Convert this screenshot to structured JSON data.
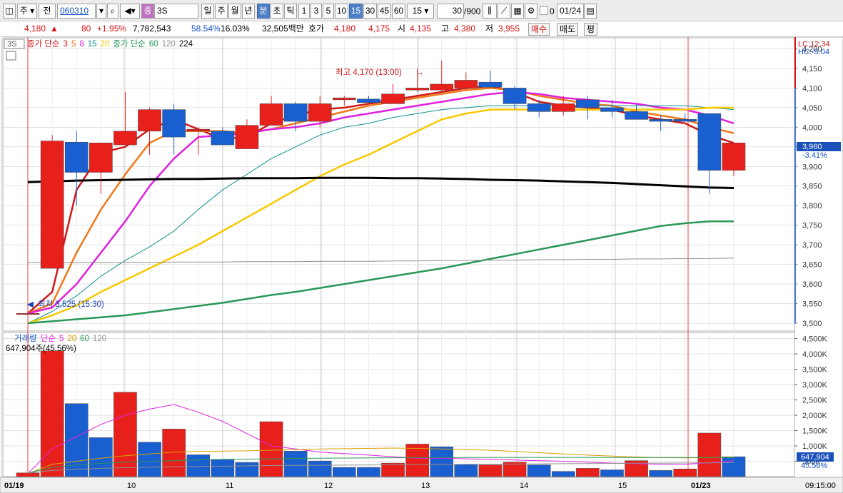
{
  "toolbar": {
    "market": "주",
    "prev": "전",
    "code": "060310",
    "stock_name": "3S",
    "period_buttons": [
      "일",
      "주",
      "월",
      "년",
      "분",
      "초",
      "틱"
    ],
    "active_period": "분",
    "minute_buttons": [
      "1",
      "3",
      "5",
      "10",
      "15",
      "30",
      "45",
      "60"
    ],
    "active_minute": "15",
    "minute_select": "15",
    "count": "30",
    "count_max": "/900",
    "date": "01/24",
    "checkbox_label": "0"
  },
  "infobar": {
    "price": "4,180",
    "change_arrow": "▲",
    "change": "80",
    "change_pct": "+1.95%",
    "volume": "7,782,543",
    "vol_ratio": "58.54%",
    "turnover": "16.03%",
    "amount": "32,505백만",
    "quote_label": "호가",
    "ask": "4,180",
    "bid": "4,175",
    "open_label": "시",
    "open": "4,135",
    "high_label": "고",
    "high": "4,380",
    "low_label": "저",
    "low": "3,955",
    "buy_label": "매수",
    "sell_label": "매도",
    "eval_label": "평"
  },
  "price_panel": {
    "name_tag": "3S",
    "legend": [
      {
        "text": "종가 단순",
        "color": "#d01818"
      },
      {
        "text": "3",
        "color": "#d01818"
      },
      {
        "text": "5",
        "color": "#f07818"
      },
      {
        "text": "8",
        "color": "#e020e0"
      },
      {
        "text": "15",
        "color": "#109090"
      },
      {
        "text": "20",
        "color": "#f8c800"
      },
      {
        "text": "종가 단순",
        "color": "#289858"
      },
      {
        "text": "60",
        "color": "#289858"
      },
      {
        "text": "120",
        "color": "#909090"
      },
      {
        "text": "224",
        "color": "#000000"
      }
    ],
    "lc": "LC:12.34",
    "hc": "HC:-5.04",
    "current_price": "3,960",
    "current_pct": "-3.41%",
    "high_annot": "최고 4,170 (13:00)",
    "low_annot": "최저 3,525 (15:30)"
  },
  "volume_panel": {
    "legend": [
      {
        "text": "거래량",
        "color": "#1450c8"
      },
      {
        "text": "단순",
        "color": "#e020e0"
      },
      {
        "text": "5",
        "color": "#e020e0"
      },
      {
        "text": "20",
        "color": "#d8a000"
      },
      {
        "text": "60",
        "color": "#289858"
      },
      {
        "text": "120",
        "color": "#909090"
      }
    ],
    "summary": "647,904주(45.56%)",
    "current_volume": "647,904",
    "current_pct": "45.56%"
  },
  "colors": {
    "up": "#e8201c",
    "down": "#1a5fd0",
    "grid": "#d0d0d0"
  },
  "chart_data": [
    {
      "type": "candlestick",
      "y_ticks": [
        "4,200",
        "4,150",
        "4,100",
        "4,050",
        "4,000",
        "3,950",
        "3,900",
        "3,850",
        "3,800",
        "3,750",
        "3,700",
        "3,650",
        "3,600",
        "3,550",
        "3,500"
      ],
      "ylim": [
        3480,
        4230
      ],
      "x_labels": [
        "01/19",
        "10",
        "11",
        "12",
        "13",
        "14",
        "15",
        "01/23",
        "09:15:00"
      ],
      "candles": [
        {
          "o": 3525,
          "h": 3530,
          "l": 3525,
          "c": 3525
        },
        {
          "o": 3640,
          "h": 3980,
          "l": 3640,
          "c": 3965
        },
        {
          "o": 3962,
          "h": 3990,
          "l": 3800,
          "c": 3885
        },
        {
          "o": 3885,
          "h": 3960,
          "l": 3830,
          "c": 3960
        },
        {
          "o": 3955,
          "h": 4090,
          "l": 3955,
          "c": 3990
        },
        {
          "o": 3990,
          "h": 4050,
          "l": 3930,
          "c": 4045
        },
        {
          "o": 4045,
          "h": 4060,
          "l": 3930,
          "c": 3975
        },
        {
          "o": 3990,
          "h": 4000,
          "l": 3930,
          "c": 3995
        },
        {
          "o": 3990,
          "h": 4000,
          "l": 3955,
          "c": 3955
        },
        {
          "o": 3945,
          "h": 4020,
          "l": 3945,
          "c": 4005
        },
        {
          "o": 4005,
          "h": 4080,
          "l": 4005,
          "c": 4060
        },
        {
          "o": 4060,
          "h": 4065,
          "l": 3990,
          "c": 4015
        },
        {
          "o": 4015,
          "h": 4080,
          "l": 4000,
          "c": 4060
        },
        {
          "o": 4070,
          "h": 4080,
          "l": 4055,
          "c": 4075
        },
        {
          "o": 4072,
          "h": 4080,
          "l": 4060,
          "c": 4063
        },
        {
          "o": 4060,
          "h": 4110,
          "l": 4060,
          "c": 4085
        },
        {
          "o": 4095,
          "h": 4150,
          "l": 4090,
          "c": 4100
        },
        {
          "o": 4095,
          "h": 4170,
          "l": 4090,
          "c": 4110
        },
        {
          "o": 4100,
          "h": 4140,
          "l": 4095,
          "c": 4120
        },
        {
          "o": 4115,
          "h": 4145,
          "l": 4105,
          "c": 4102
        },
        {
          "o": 4100,
          "h": 4105,
          "l": 4045,
          "c": 4060
        },
        {
          "o": 4060,
          "h": 4070,
          "l": 4025,
          "c": 4040
        },
        {
          "o": 4040,
          "h": 4080,
          "l": 4030,
          "c": 4060
        },
        {
          "o": 4070,
          "h": 4080,
          "l": 4020,
          "c": 4050
        },
        {
          "o": 4050,
          "h": 4070,
          "l": 4025,
          "c": 4040
        },
        {
          "o": 4040,
          "h": 4060,
          "l": 4040,
          "c": 4020
        },
        {
          "o": 4020,
          "h": 4030,
          "l": 3990,
          "c": 4015
        },
        {
          "o": 4020,
          "h": 4035,
          "l": 4015,
          "c": 4015
        },
        {
          "o": 4035,
          "h": 4035,
          "l": 3830,
          "c": 3890
        },
        {
          "o": 3890,
          "h": 3960,
          "l": 3875,
          "c": 3960
        }
      ],
      "series": [
        {
          "name": "3",
          "color": "#d01818",
          "width": 2.5,
          "values": [
            3525,
            3580,
            3840,
            3935,
            3950,
            3995,
            4020,
            3995,
            3970,
            3975,
            4010,
            4030,
            4045,
            4050,
            4060,
            4070,
            4080,
            4090,
            4100,
            4105,
            4090,
            4065,
            4055,
            4050,
            4045,
            4030,
            4020,
            4010,
            3980,
            3960
          ]
        },
        {
          "name": "5",
          "color": "#f07818",
          "width": 2.5,
          "values": [
            3525,
            3550,
            3680,
            3790,
            3880,
            3960,
            3990,
            3990,
            3990,
            3985,
            3995,
            4010,
            4025,
            4040,
            4055,
            4065,
            4075,
            4085,
            4095,
            4100,
            4095,
            4080,
            4070,
            4060,
            4055,
            4040,
            4030,
            4020,
            4000,
            3985
          ]
        },
        {
          "name": "8",
          "color": "#e020e0",
          "width": 2.5,
          "values": [
            3525,
            3540,
            3600,
            3680,
            3760,
            3850,
            3920,
            3975,
            3980,
            3985,
            3995,
            4000,
            4010,
            4025,
            4035,
            4045,
            4055,
            4065,
            4075,
            4085,
            4090,
            4085,
            4075,
            4070,
            4065,
            4060,
            4050,
            4045,
            4030,
            4010
          ]
        },
        {
          "name": "15",
          "color": "#109090",
          "width": 1,
          "values": [
            3500,
            3530,
            3570,
            3620,
            3660,
            3695,
            3735,
            3790,
            3840,
            3880,
            3920,
            3950,
            3980,
            4000,
            4010,
            4025,
            4035,
            4045,
            4050,
            4055,
            4055,
            4055,
            4055,
            4055,
            4055,
            4055,
            4055,
            4055,
            4050,
            4045
          ]
        },
        {
          "name": "20",
          "color": "#f8c800",
          "width": 2.5,
          "values": [
            3500,
            3520,
            3545,
            3580,
            3610,
            3640,
            3670,
            3700,
            3735,
            3770,
            3805,
            3840,
            3875,
            3905,
            3930,
            3960,
            3990,
            4020,
            4035,
            4045,
            4045,
            4045,
            4045,
            4045,
            4045,
            4045,
            4045,
            4045,
            4050,
            4050
          ]
        },
        {
          "name": "60",
          "color": "#289858",
          "width": 2.5,
          "values": [
            3500,
            3505,
            3510,
            3515,
            3520,
            3528,
            3536,
            3544,
            3552,
            3562,
            3572,
            3580,
            3590,
            3600,
            3610,
            3620,
            3630,
            3640,
            3652,
            3664,
            3676,
            3688,
            3700,
            3712,
            3724,
            3736,
            3748,
            3755,
            3760,
            3760
          ]
        },
        {
          "name": "120",
          "color": "#909090",
          "width": 1,
          "values": [
            3655,
            3655,
            3655,
            3655,
            3655,
            3655,
            3656,
            3656,
            3656,
            3657,
            3657,
            3657,
            3658,
            3658,
            3658,
            3659,
            3659,
            3660,
            3660,
            3661,
            3661,
            3662,
            3662,
            3663,
            3663,
            3664,
            3664,
            3665,
            3665,
            3666
          ]
        },
        {
          "name": "224",
          "color": "#000000",
          "width": 3,
          "values": [
            3860,
            3862,
            3864,
            3865,
            3866,
            3867,
            3868,
            3868,
            3869,
            3870,
            3870,
            3870,
            3871,
            3871,
            3871,
            3870,
            3870,
            3869,
            3868,
            3866,
            3865,
            3864,
            3862,
            3860,
            3858,
            3855,
            3852,
            3849,
            3846,
            3845
          ]
        }
      ]
    },
    {
      "type": "bar",
      "y_ticks": [
        "4,500K",
        "4,000K",
        "3,500K",
        "3,000K",
        "2,500K",
        "2,000K",
        "1,500K",
        "1,000K",
        "500K"
      ],
      "ylim": [
        0,
        4700000
      ],
      "values": [
        120000,
        4100000,
        2380000,
        1270000,
        2750000,
        1120000,
        1550000,
        710000,
        560000,
        460000,
        1790000,
        830000,
        510000,
        300000,
        300000,
        440000,
        1060000,
        970000,
        400000,
        380000,
        470000,
        380000,
        170000,
        270000,
        220000,
        520000,
        200000,
        250000,
        1420000,
        647904
      ],
      "up": [
        true,
        true,
        false,
        false,
        true,
        false,
        true,
        false,
        false,
        false,
        true,
        false,
        false,
        false,
        false,
        true,
        true,
        false,
        false,
        true,
        true,
        false,
        false,
        true,
        false,
        true,
        false,
        true,
        true,
        false
      ],
      "series": [
        {
          "name": "5",
          "color": "#e020e0",
          "values": [
            100000,
            900000,
            1300000,
            1700000,
            2000000,
            2200000,
            2350000,
            2100000,
            1800000,
            1400000,
            1000000,
            900000,
            800000,
            750000,
            700000,
            650000,
            600000,
            600000,
            580000,
            560000,
            540000,
            520000,
            500000,
            470000,
            440000,
            420000,
            400000,
            400000,
            450000,
            520000
          ]
        },
        {
          "name": "20",
          "color": "#d8a000",
          "values": [
            100000,
            400000,
            500000,
            600000,
            680000,
            740000,
            800000,
            820000,
            830000,
            840000,
            860000,
            880000,
            900000,
            910000,
            920000,
            930000,
            920000,
            900000,
            880000,
            860000,
            820000,
            780000,
            740000,
            700000,
            670000,
            640000,
            620000,
            610000,
            620000,
            640000
          ]
        },
        {
          "name": "60",
          "color": "#289858",
          "values": [
            120000,
            300000,
            380000,
            430000,
            470000,
            500000,
            520000,
            540000,
            560000,
            570000,
            580000,
            590000,
            600000,
            605000,
            610000,
            615000,
            620000,
            622000,
            624000,
            625000,
            626000,
            626000,
            626000,
            625000,
            624000,
            623000,
            622000,
            622000,
            624000,
            626000
          ]
        },
        {
          "name": "120",
          "color": "#909090",
          "values": [
            120000,
            200000,
            240000,
            270000,
            290000,
            310000,
            320000,
            330000,
            340000,
            350000,
            360000,
            365000,
            370000,
            375000,
            380000,
            385000,
            390000,
            395000,
            400000,
            405000,
            410000,
            415000,
            420000,
            425000,
            430000,
            435000,
            440000,
            445000,
            450000,
            455000
          ]
        }
      ]
    }
  ]
}
